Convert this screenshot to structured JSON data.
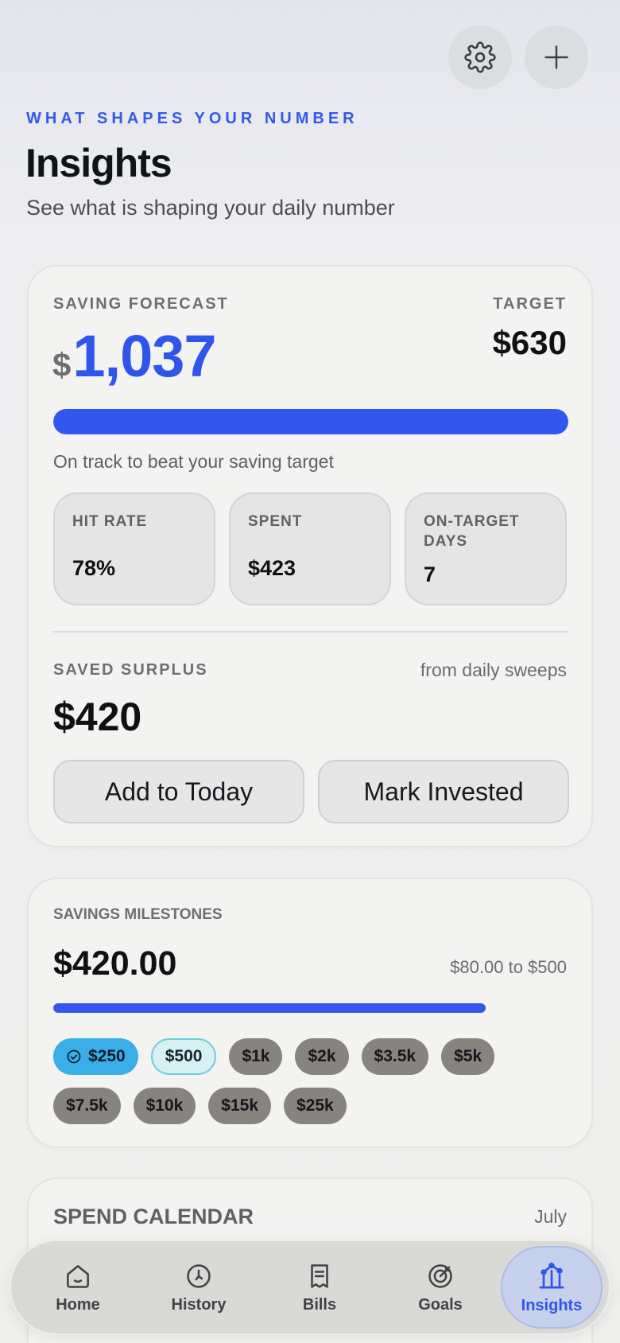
{
  "header": {
    "eyebrow": "WHAT SHAPES YOUR NUMBER",
    "title": "Insights",
    "subtitle": "See what is shaping your daily number"
  },
  "forecast": {
    "label": "SAVING FORECAST",
    "currency": "$",
    "value": "1,037",
    "target_label": "TARGET",
    "target_value": "$630",
    "progress": 1.0,
    "status": "On track to beat your saving target",
    "stats": [
      {
        "label": "HIT RATE",
        "value": "78%"
      },
      {
        "label": "SPENT",
        "value": "$423"
      },
      {
        "label": "ON-TARGET DAYS",
        "value": "7"
      }
    ],
    "surplus_label": "SAVED SURPLUS",
    "surplus_note": "from daily sweeps",
    "surplus_value": "$420",
    "add_button": "Add to Today",
    "invest_button": "Mark Invested"
  },
  "milestones": {
    "label": "SAVINGS MILESTONES",
    "value": "$420.00",
    "note": "$80.00 to $500",
    "progress": 0.84,
    "chips": [
      "$250",
      "$500",
      "$1k",
      "$2k",
      "$3.5k",
      "$5k",
      "$7.5k",
      "$10k",
      "$15k",
      "$25k"
    ]
  },
  "calendar": {
    "label": "SPEND CALENDAR",
    "month": "July"
  },
  "nav": {
    "items": [
      "Home",
      "History",
      "Bills",
      "Goals",
      "Insights"
    ],
    "active": "Insights"
  },
  "colors": {
    "accent": "#2f55eb",
    "chip_done": "#3aaee8",
    "chip_next": "#d7f0f4",
    "chip_locked": "#87837e"
  }
}
